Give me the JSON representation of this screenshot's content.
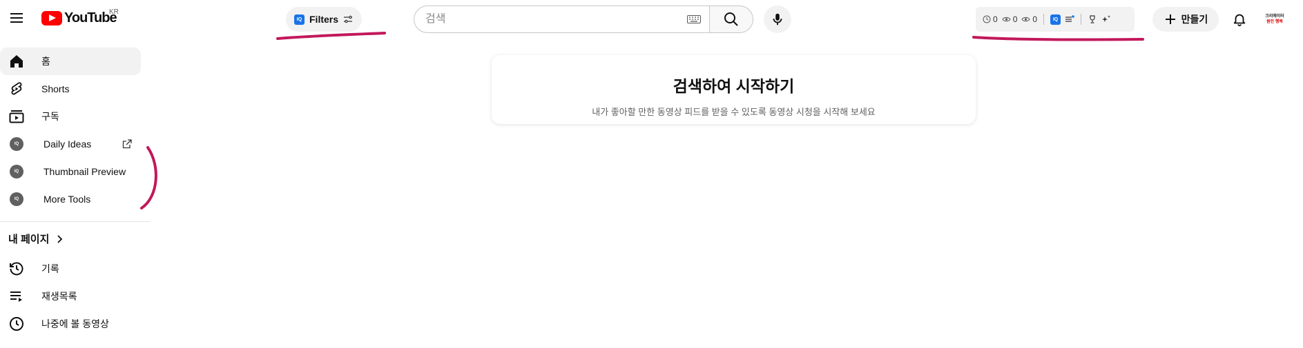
{
  "header": {
    "logo_text": "YouTube",
    "region": "KR",
    "filters_label": "Filters",
    "search_placeholder": "검색",
    "stats": [
      "0",
      "0",
      "0"
    ],
    "create_label": "만들기",
    "avatar_line1": "크리에이터",
    "avatar_line2": "원인 행복"
  },
  "sidebar": {
    "items": [
      {
        "label": "홈"
      },
      {
        "label": "Shorts"
      },
      {
        "label": "구독"
      },
      {
        "label": "Daily Ideas"
      },
      {
        "label": "Thumbnail Preview"
      },
      {
        "label": "More Tools"
      }
    ],
    "section_title": "내 페이지",
    "section_items": [
      {
        "label": "기록"
      },
      {
        "label": "재생목록"
      },
      {
        "label": "나중에 볼 동영상"
      }
    ]
  },
  "main": {
    "title": "검색하여 시작하기",
    "subtitle": "내가 좋아할 만한 동영상 피드를 받을 수 있도록 동영상 시청을 시작해 보세요"
  },
  "colors": {
    "brand_red": "#ff0000",
    "annotation": "#c2185b",
    "iq_blue": "#1a73e8"
  }
}
